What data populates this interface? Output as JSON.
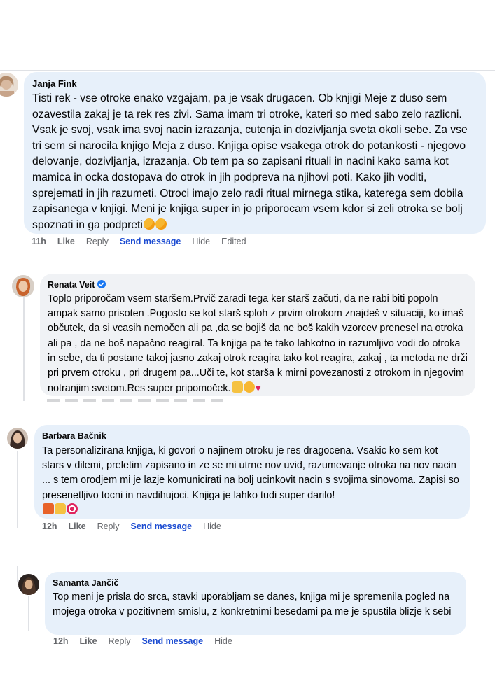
{
  "comments": [
    {
      "author": "Janja Fink",
      "text": "Tisti rek - vse otroke enako vzgajam, pa je vsak drugacen. Ob knjigi Meje z duso sem ozavestila zakaj je ta rek res zivi. Sama imam tri otroke, kateri so med sabo zelo razlicni. Vsak je svoj, vsak ima svoj nacin izrazanja, cutenja in dozivljanja sveta okoli sebe. Za vse tri sem si narocila knjigo Meja z duso. Knjiga opise vsakega otrok do potankosti - njegovo delovanje, dozivljanja, izrazanja. Ob tem pa so zapisani rituali in nacini kako sama kot mamica in ocka dostopava do otrok in jih podpreva na njihovi poti. Kako jih voditi, sprejemati in jih razumeti. Otroci imajo zelo radi ritual mirnega stika, katerega sem dobila zapisanega v knjigi. Meni je knjiga super in jo priporocam vsem kdor si zeli otroka se bolj spoznati in ga podpreti",
      "time": "11h",
      "like": "Like",
      "reply": "Reply",
      "send": "Send message",
      "hide": "Hide",
      "edited": "Edited",
      "emoji": [
        "smiling-face-with-hearts",
        "smiling-face-with-hearts"
      ]
    },
    {
      "author": "Renata Veit",
      "text": "Toplo priporočam vsem staršem.Prvič zaradi tega ker starš začuti, da ne rabi biti popoln ampak samo prisoten .Pogosto se kot starš sploh z prvim otrokom znajdeš v situaciji, ko imaš občutek, da si vcasih nemočen ali pa ,da se bojiš da ne boš kakih vzorcev prenesel na otroka ali pa , da ne boš napačno reagiral. Ta knjiga pa te tako lahkotno in razumljivo vodi do otroka in sebe, da ti postane takoj jasno zakaj otrok reagira tako kot reagira, zakaj , ta metoda ne drži pri prvem otroku , pri drugem pa...Uči te, kot starša k mirni povezanosti z otrokom in njegovim notranjim svetom.Res super pripomoček.",
      "emoji": [
        "ok-hand",
        "smiling-face",
        "red-heart"
      ]
    },
    {
      "author": "Barbara Bačnik",
      "text": "Ta personalizirana knjiga, ki govori o najinem otroku je res dragocena. Vsakic ko sem kot stars v dilemi, preletim zapisano in ze se mi utrne nov uvid, razumevanje otroka na nov nacin ... s tem orodjem mi je lazje komunicirati na bolj ucinkovit nacin s svojima sinovoma. Zapisi so presenetljivo tocni in navdihujoci. Knjiga je lahko tudi super darilo!",
      "time": "12h",
      "like": "Like",
      "reply": "Reply",
      "send": "Send message",
      "hide": "Hide",
      "emoji": [
        "gift",
        "thumbs-up",
        "direct-hit"
      ]
    },
    {
      "author": "Samanta Jančič",
      "text": "Top meni je prisla do srca, stavki uporabljam se danes, knjiga mi je spremenila pogled na mojega otroka v pozitivnem smislu, z konkretnimi besedami pa me je spustila blizje k sebi",
      "time": "12h",
      "like": "Like",
      "reply": "Reply",
      "send": "Send message",
      "hide": "Hide"
    }
  ],
  "colors": {
    "bubble_gray": "#f0f2f5",
    "bubble_blue": "#e7f0fa",
    "link_blue": "#1b4bd1",
    "meta_gray": "#65676b",
    "verified_blue": "#1877f2"
  }
}
